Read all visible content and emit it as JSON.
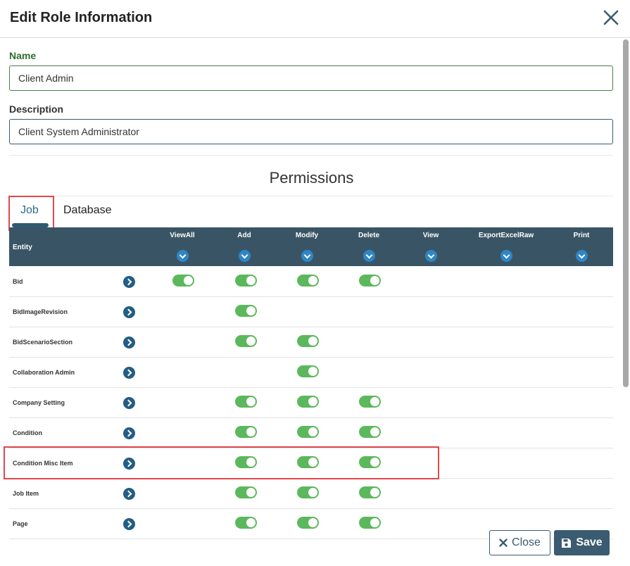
{
  "modal": {
    "title": "Edit Role Information",
    "close_icon": "close-icon"
  },
  "form": {
    "name_label": "Name",
    "name_value": "Client Admin",
    "description_label": "Description",
    "description_value": "Client System Administrator"
  },
  "permissions": {
    "title": "Permissions",
    "tabs": [
      {
        "label": "Job",
        "active": true
      },
      {
        "label": "Database",
        "active": false
      }
    ],
    "entity_header": "Entity",
    "columns": [
      "ViewAll",
      "Add",
      "Modify",
      "Delete",
      "View",
      "ExportExcelRaw",
      "Print"
    ],
    "rows": [
      {
        "entity": "Bid",
        "on": [
          "ViewAll",
          "Add",
          "Modify",
          "Delete"
        ]
      },
      {
        "entity": "BidImageRevision",
        "on": [
          "Add"
        ]
      },
      {
        "entity": "BidScenarioSection",
        "on": [
          "Add",
          "Modify"
        ]
      },
      {
        "entity": "Collaboration Admin",
        "on": [
          "Modify"
        ]
      },
      {
        "entity": "Company Setting",
        "on": [
          "Add",
          "Modify",
          "Delete"
        ]
      },
      {
        "entity": "Condition",
        "on": [
          "Add",
          "Modify",
          "Delete"
        ]
      },
      {
        "entity": "Condition Misc Item",
        "on": [
          "Add",
          "Modify",
          "Delete"
        ]
      },
      {
        "entity": "Job Item",
        "on": [
          "Add",
          "Modify",
          "Delete"
        ]
      },
      {
        "entity": "Page",
        "on": [
          "Add",
          "Modify",
          "Delete"
        ]
      }
    ]
  },
  "footer": {
    "close_label": "Close",
    "save_label": "Save"
  },
  "colors": {
    "header_bg": "#395565",
    "toggle_on": "#5cb85c",
    "highlight": "#e0474c",
    "accent": "#3b5b70"
  }
}
